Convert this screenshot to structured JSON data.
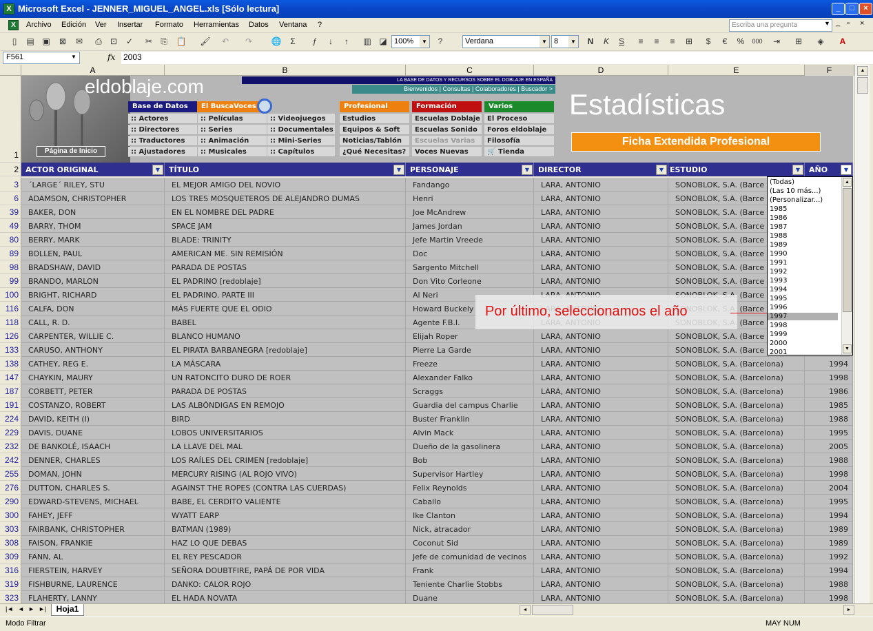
{
  "window": {
    "title": "Microsoft Excel - JENNER_MIGUEL_ANGEL.xls  [Sólo lectura]"
  },
  "menu": [
    "Archivo",
    "Edición",
    "Ver",
    "Insertar",
    "Formato",
    "Herramientas",
    "Datos",
    "Ventana",
    "?"
  ],
  "ask_placeholder": "Escriba una pregunta",
  "toolbar": {
    "zoom": "100%",
    "font": "Verdana",
    "size": "8"
  },
  "formula": {
    "cell": "F561",
    "fx": "fx",
    "value": "2003"
  },
  "columns": [
    "A",
    "B",
    "C",
    "D",
    "E",
    "F"
  ],
  "banner": {
    "logo": "eldoblaje.com",
    "tagline": "LA BASE DE DATOS Y RECURSOS SOBRE EL DOBLAJE EN ESPAÑA",
    "toplinks": "Bienvenidos | Consultas | Colaboradores | Buscador >",
    "home": "Página de Inicio",
    "row_label": "1",
    "title": "Estadísticas",
    "subtitle": "Ficha Extendida Profesional",
    "nav": {
      "base_hdr": "Base de Datos",
      "busca_hdr": "El BuscaVoces",
      "base": [
        ":: Actores",
        ":: Directores",
        ":: Traductores",
        ":: Ajustadores"
      ],
      "col2": [
        ":: Películas",
        ":: Series",
        ":: Animación",
        ":: Musicales"
      ],
      "col3": [
        ":: Videojuegos",
        ":: Documentales",
        ":: Mini-Series",
        ":: Capítulos"
      ],
      "prof_hdr": "Profesional",
      "prof": [
        "Estudios",
        "Equipos & Soft",
        "Noticias/Tablón",
        "¿Qué Necesitas?"
      ],
      "form_hdr": "Formación",
      "form": [
        "Escuelas Doblaje",
        "Escuelas Sonido",
        "Escuelas Varias",
        "Voces Nuevas"
      ],
      "varios_hdr": "Varios",
      "varios": [
        "El Proceso",
        "Foros eldoblaje",
        "Filosofía",
        "Tienda"
      ]
    }
  },
  "header": {
    "row": "2",
    "cells": [
      "ACTOR ORIGINAL",
      "TÍTULO",
      "PERSONAJE",
      "DIRECTOR",
      "ESTUDIO",
      "AÑO"
    ]
  },
  "rows": [
    {
      "n": "3",
      "a": "´LARGE´ RILEY, STU",
      "b": "EL MEJOR AMIGO DEL NOVIO",
      "c": "Fandango",
      "d": "LARA, ANTONIO",
      "e": "SONOBLOK, S.A. (Barce",
      "f": ""
    },
    {
      "n": "6",
      "a": "ADAMSON, CHRISTOPHER",
      "b": "LOS TRES MOSQUETEROS DE ALEJANDRO DUMAS",
      "c": "Henri",
      "d": "LARA, ANTONIO",
      "e": "SONOBLOK, S.A. (Barce",
      "f": ""
    },
    {
      "n": "39",
      "a": "BAKER, DON",
      "b": "EN EL NOMBRE DEL PADRE",
      "c": "Joe McAndrew",
      "d": "LARA, ANTONIO",
      "e": "SONOBLOK, S.A. (Barce",
      "f": ""
    },
    {
      "n": "49",
      "a": "BARRY, THOM",
      "b": "SPACE JAM",
      "c": "James Jordan",
      "d": "LARA, ANTONIO",
      "e": "SONOBLOK, S.A. (Barce",
      "f": ""
    },
    {
      "n": "80",
      "a": "BERRY, MARK",
      "b": "BLADE: TRINITY",
      "c": "Jefe Martin Vreede",
      "d": "LARA, ANTONIO",
      "e": "SONOBLOK, S.A. (Barce",
      "f": ""
    },
    {
      "n": "89",
      "a": "BOLLEN, PAUL",
      "b": "AMERICAN ME. SIN REMISIÓN",
      "c": "Doc",
      "d": "LARA, ANTONIO",
      "e": "SONOBLOK, S.A. (Barce",
      "f": ""
    },
    {
      "n": "98",
      "a": "BRADSHAW, DAVID",
      "b": "PARADA DE POSTAS",
      "c": "Sargento Mitchell",
      "d": "LARA, ANTONIO",
      "e": "SONOBLOK, S.A. (Barce",
      "f": ""
    },
    {
      "n": "99",
      "a": "BRANDO, MARLON",
      "b": "EL PADRINO [redoblaje]",
      "c": "Don Vito Corleone",
      "d": "LARA, ANTONIO",
      "e": "SONOBLOK, S.A. (Barce",
      "f": ""
    },
    {
      "n": "100",
      "a": "BRIGHT, RICHARD",
      "b": "EL PADRINO. PARTE III",
      "c": "Al Neri",
      "d": "LARA, ANTONIO",
      "e": "SONOBLOK, S.A. (Barce",
      "f": ""
    },
    {
      "n": "116",
      "a": "CALFA, DON",
      "b": "MÁS FUERTE QUE EL ODIO",
      "c": "Howard Buckely",
      "d": "LARA, ANTONIO",
      "e": "SONOBLOK, S.A. (Barce",
      "f": ""
    },
    {
      "n": "118",
      "a": "CALL, R. D.",
      "b": "BABEL",
      "c": "Agente F.B.I.",
      "d": "LARA, ANTONIO",
      "e": "SONOBLOK, S.A. (Barce",
      "f": ""
    },
    {
      "n": "126",
      "a": "CARPENTER, WILLIE C.",
      "b": "BLANCO HUMANO",
      "c": "Elijah Roper",
      "d": "LARA, ANTONIO",
      "e": "SONOBLOK, S.A. (Barce",
      "f": ""
    },
    {
      "n": "133",
      "a": "CARUSO, ANTHONY",
      "b": "EL PIRATA BARBANEGRA [redoblaje]",
      "c": "Pierre La Garde",
      "d": "LARA, ANTONIO",
      "e": "SONOBLOK, S.A. (Barce",
      "f": ""
    },
    {
      "n": "138",
      "a": "CATHEY, REG E.",
      "b": "LA MÁSCARA",
      "c": "Freeze",
      "d": "LARA, ANTONIO",
      "e": "SONOBLOK, S.A. (Barcelona)",
      "f": "1994"
    },
    {
      "n": "147",
      "a": "CHAYKIN, MAURY",
      "b": "UN RATONCITO DURO DE ROER",
      "c": "Alexander Falko",
      "d": "LARA, ANTONIO",
      "e": "SONOBLOK, S.A. (Barcelona)",
      "f": "1998"
    },
    {
      "n": "187",
      "a": "CORBETT, PETER",
      "b": "PARADA DE POSTAS",
      "c": "Scraggs",
      "d": "LARA, ANTONIO",
      "e": "SONOBLOK, S.A. (Barcelona)",
      "f": "1986"
    },
    {
      "n": "191",
      "a": "COSTANZO, ROBERT",
      "b": "LAS ALBÓNDIGAS EN REMOJO",
      "c": "Guardia del campus Charlie",
      "d": "LARA, ANTONIO",
      "e": "SONOBLOK, S.A. (Barcelona)",
      "f": "1985"
    },
    {
      "n": "224",
      "a": "DAVID, KEITH (I)",
      "b": "BIRD",
      "c": "Buster Franklin",
      "d": "LARA, ANTONIO",
      "e": "SONOBLOK, S.A. (Barcelona)",
      "f": "1988"
    },
    {
      "n": "229",
      "a": "DAVIS, DUANE",
      "b": "LOBOS UNIVERSITARIOS",
      "c": "Alvin Mack",
      "d": "LARA, ANTONIO",
      "e": "SONOBLOK, S.A. (Barcelona)",
      "f": "1995"
    },
    {
      "n": "232",
      "a": "DE BANKOLÉ, ISAACH",
      "b": "LA LLAVE DEL MAL",
      "c": "Dueño de la gasolinera",
      "d": "LARA, ANTONIO",
      "e": "SONOBLOK, S.A. (Barcelona)",
      "f": "2005"
    },
    {
      "n": "242",
      "a": "DENNER, CHARLES",
      "b": "LOS RAÍLES DEL CRIMEN [redoblaje]",
      "c": "Bob",
      "d": "LARA, ANTONIO",
      "e": "SONOBLOK, S.A. (Barcelona)",
      "f": "1988"
    },
    {
      "n": "255",
      "a": "DOMAN, JOHN",
      "b": "MERCURY RISING (AL ROJO VIVO)",
      "c": "Supervisor Hartley",
      "d": "LARA, ANTONIO",
      "e": "SONOBLOK, S.A. (Barcelona)",
      "f": "1998"
    },
    {
      "n": "276",
      "a": "DUTTON, CHARLES S.",
      "b": "AGAINST THE ROPES (CONTRA LAS CUERDAS)",
      "c": "Felix Reynolds",
      "d": "LARA, ANTONIO",
      "e": "SONOBLOK, S.A. (Barcelona)",
      "f": "2004"
    },
    {
      "n": "290",
      "a": "EDWARD-STEVENS, MICHAEL",
      "b": "BABE, EL CERDITO VALIENTE",
      "c": "Caballo",
      "d": "LARA, ANTONIO",
      "e": "SONOBLOK, S.A. (Barcelona)",
      "f": "1995"
    },
    {
      "n": "300",
      "a": "FAHEY, JEFF",
      "b": "WYATT EARP",
      "c": "Ike Clanton",
      "d": "LARA, ANTONIO",
      "e": "SONOBLOK, S.A. (Barcelona)",
      "f": "1994"
    },
    {
      "n": "303",
      "a": "FAIRBANK, CHRISTOPHER",
      "b": "BATMAN (1989)",
      "c": "Nick, atracador",
      "d": "LARA, ANTONIO",
      "e": "SONOBLOK, S.A. (Barcelona)",
      "f": "1989"
    },
    {
      "n": "308",
      "a": "FAISON, FRANKIE",
      "b": "HAZ LO QUE DEBAS",
      "c": "Coconut Sid",
      "d": "LARA, ANTONIO",
      "e": "SONOBLOK, S.A. (Barcelona)",
      "f": "1989"
    },
    {
      "n": "309",
      "a": "FANN, AL",
      "b": "EL REY PESCADOR",
      "c": "Jefe de comunidad de vecinos",
      "d": "LARA, ANTONIO",
      "e": "SONOBLOK, S.A. (Barcelona)",
      "f": "1992"
    },
    {
      "n": "316",
      "a": "FIERSTEIN, HARVEY",
      "b": "SEÑORA DOUBTFIRE, PAPÁ DE POR VIDA",
      "c": "Frank",
      "d": "LARA, ANTONIO",
      "e": "SONOBLOK, S.A. (Barcelona)",
      "f": "1994"
    },
    {
      "n": "319",
      "a": "FISHBURNE, LAURENCE",
      "b": "DANKO: CALOR ROJO",
      "c": "Teniente Charlie Stobbs",
      "d": "LARA, ANTONIO",
      "e": "SONOBLOK, S.A. (Barcelona)",
      "f": "1988"
    },
    {
      "n": "323",
      "a": "FLAHERTY, LANNY",
      "b": "EL HADA NOVATA",
      "c": "Duane",
      "d": "LARA, ANTONIO",
      "e": "SONOBLOK, S.A. (Barcelona)",
      "f": "1998"
    }
  ],
  "dropdown": [
    "(Todas)",
    "(Las 10 más...)",
    "(Personalizar...)",
    "1985",
    "1986",
    "1987",
    "1988",
    "1989",
    "1990",
    "1991",
    "1992",
    "1993",
    "1994",
    "1995",
    "1996",
    "1997",
    "1998",
    "1999",
    "2000",
    "2001"
  ],
  "dropdown_selected": "1997",
  "callout": "Por último, seleccionamos el año",
  "sheet_tab": "Hoja1",
  "status": {
    "left": "Modo Filtrar",
    "right": "MAY NUM"
  }
}
